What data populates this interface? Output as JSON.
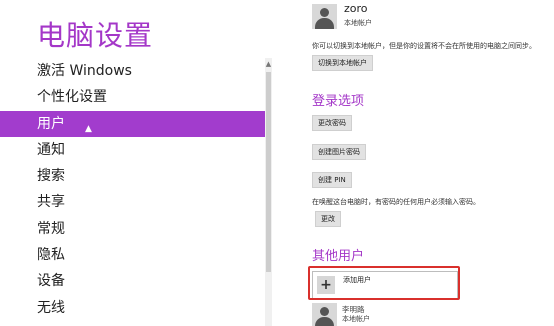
{
  "app_title": "电脑设置",
  "nav": {
    "items": [
      {
        "label": "激活 Windows"
      },
      {
        "label": "个性化设置"
      },
      {
        "label": "用户",
        "active": true
      },
      {
        "label": "通知"
      },
      {
        "label": "搜索"
      },
      {
        "label": "共享"
      },
      {
        "label": "常规"
      },
      {
        "label": "隐私"
      },
      {
        "label": "设备"
      },
      {
        "label": "无线"
      }
    ]
  },
  "current_user": {
    "name": "zoro",
    "account_type": "本地帐户",
    "description": "你可以切换到本地帐户，但是你的设置将不会在所使用的电脑之间同步。",
    "switch_button": "切换到本地帐户"
  },
  "login_options": {
    "heading": "登录选项",
    "change_password_button": "更改密码",
    "picture_password_button": "创建图片密码",
    "pin_button": "创建 PIN",
    "wake_text": "在唤醒这台电脑时，有密码的任何用户必须输入密码。",
    "change_button": "更改"
  },
  "other_users": {
    "heading": "其他用户",
    "add_user_label": "添加用户",
    "users": [
      {
        "name": "李明路",
        "account_type": "本地帐户"
      }
    ]
  },
  "colors": {
    "accent": "#a23ccd",
    "highlight_border": "#d9302c"
  },
  "icons": {
    "add": "plus-icon",
    "avatar": "user-avatar-icon",
    "cursor": "mouse-pointer-icon"
  }
}
